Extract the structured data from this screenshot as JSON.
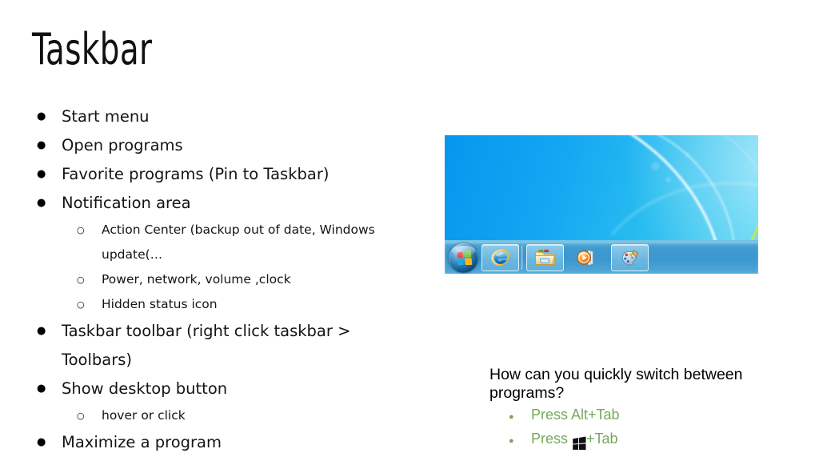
{
  "slide": {
    "title": "Taskbar",
    "bullets": [
      {
        "level": 1,
        "text": "Start menu"
      },
      {
        "level": 1,
        "text": "Open programs"
      },
      {
        "level": 1,
        "text": "Favorite programs (Pin to Taskbar)"
      },
      {
        "level": 1,
        "text": "Notification area"
      },
      {
        "level": 2,
        "text": "Action Center (backup out of date, Windows update(…"
      },
      {
        "level": 2,
        "text": "Power, network, volume ,clock"
      },
      {
        "level": 2,
        "text": "Hidden status icon"
      },
      {
        "level": 1,
        "text": "Taskbar toolbar (right click taskbar > Toolbars)"
      },
      {
        "level": 1,
        "text": "Show desktop button"
      },
      {
        "level": 2,
        "text": "hover or click"
      },
      {
        "level": 1,
        "text": "Maximize a program"
      }
    ]
  },
  "screenshot": {
    "caption_alt": "Windows 7 desktop with taskbar",
    "taskbar": {
      "start_button_label": "Start",
      "items": [
        {
          "name": "internet-explorer",
          "label": "Internet Explorer",
          "pinned_frame": true
        },
        {
          "name": "windows-explorer",
          "label": "Windows Explorer",
          "pinned_frame": true
        },
        {
          "name": "windows-media-player",
          "label": "Windows Media Player",
          "pinned_frame": false
        },
        {
          "name": "paint",
          "label": "Paint",
          "pinned_frame": true
        }
      ]
    },
    "colors": {
      "wallpaper_left": "#0497EE",
      "wallpaper_right": "#4ED2F2",
      "taskbar": "#3E9AD0",
      "ribbon": "#C8E84A"
    }
  },
  "question_box": {
    "question": "How can you quickly switch between programs?",
    "answers": [
      {
        "prefix": "Press Alt+Tab",
        "glyph": null,
        "suffix": ""
      },
      {
        "prefix": "Press ",
        "glyph": "windows-logo",
        "suffix": "+Tab"
      }
    ],
    "accent_color": "#76A85A"
  }
}
